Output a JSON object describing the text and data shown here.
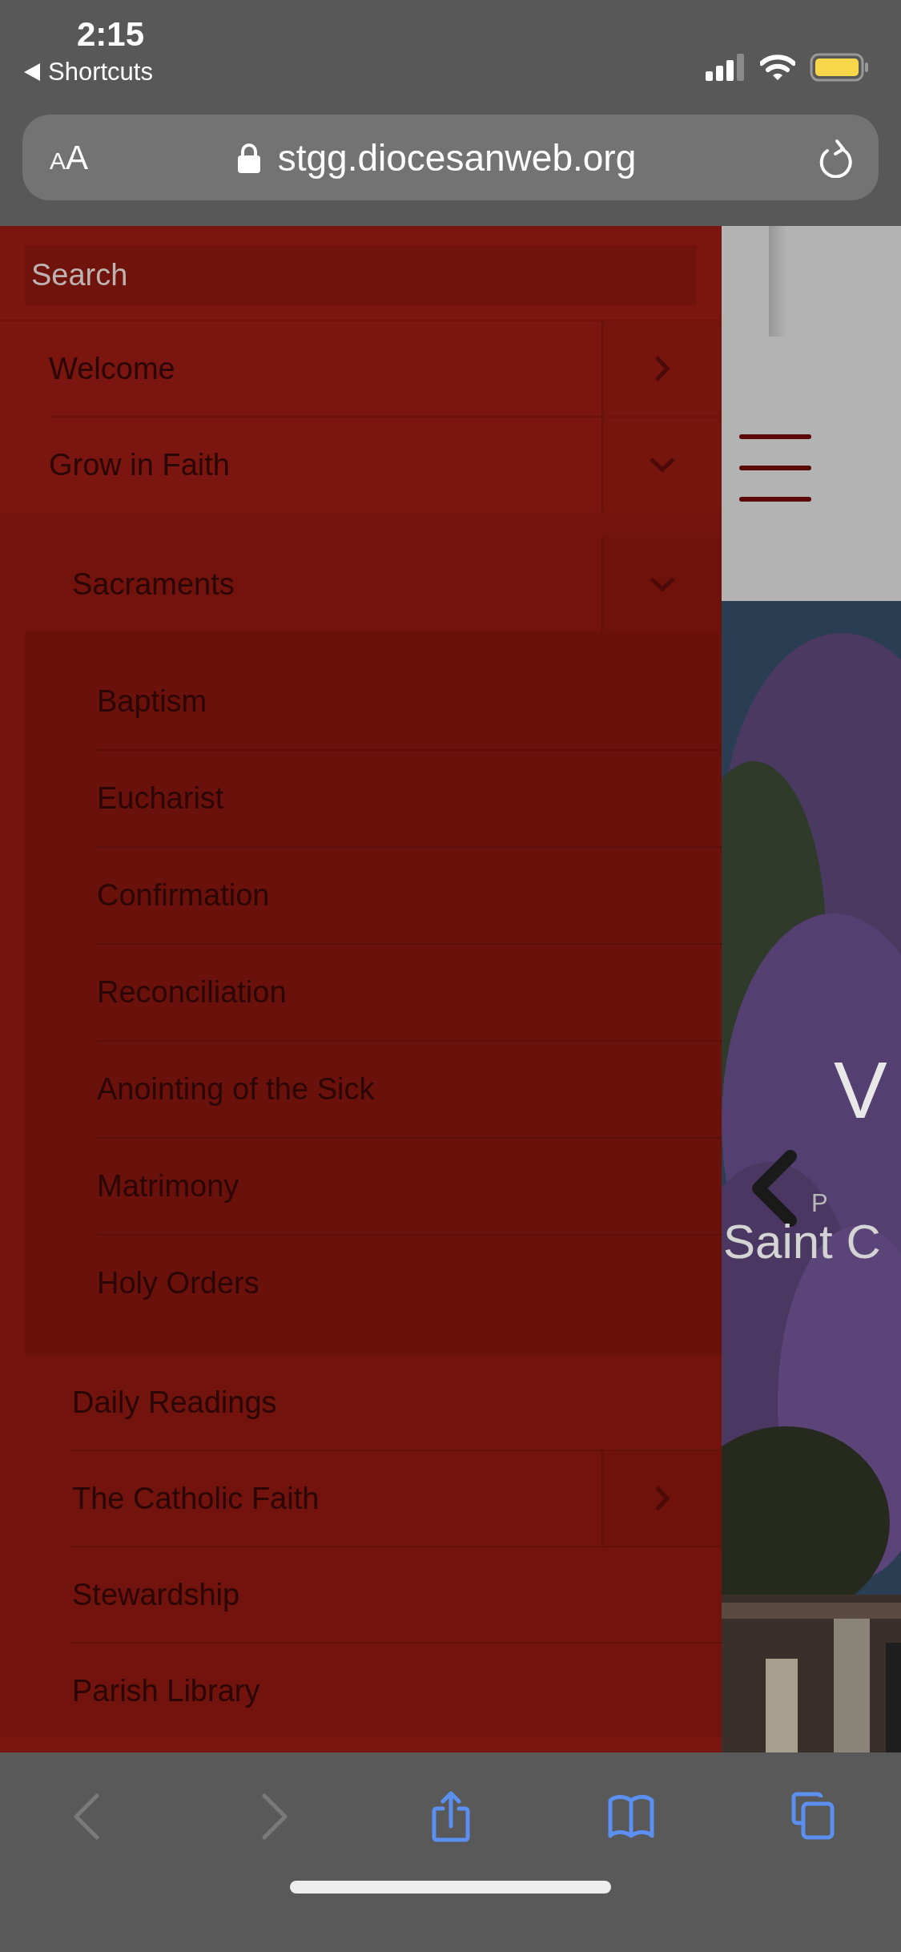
{
  "status_bar": {
    "time": "2:15",
    "back_link": "Shortcuts"
  },
  "address_bar": {
    "text_size_button": "AA",
    "url": "stgg.diocesanweb.org"
  },
  "menu": {
    "search": {
      "placeholder": "Search"
    },
    "items": [
      {
        "label": "Welcome",
        "expanded": false
      },
      {
        "label": "Grow in Faith",
        "expanded": true,
        "children": [
          {
            "label": "Sacraments",
            "expanded": true,
            "children": [
              {
                "label": "Baptism"
              },
              {
                "label": "Eucharist"
              },
              {
                "label": "Confirmation"
              },
              {
                "label": "Reconciliation"
              },
              {
                "label": "Anointing of the Sick"
              },
              {
                "label": "Matrimony"
              },
              {
                "label": "Holy Orders"
              }
            ]
          },
          {
            "label": "Daily Readings"
          },
          {
            "label": "The Catholic Faith",
            "expanded": false
          },
          {
            "label": "Stewardship"
          },
          {
            "label": "Parish Library"
          }
        ]
      }
    ]
  },
  "site": {
    "hero": {
      "kind": "picture",
      "heading": "V",
      "caption_letter": "P",
      "subtitle": "Saint C"
    }
  },
  "toolbar": [
    {
      "kind": "back",
      "disabled": true
    },
    {
      "kind": "forward",
      "disabled": true
    },
    {
      "kind": "share",
      "disabled": false
    },
    {
      "kind": "bookmarks",
      "disabled": false
    },
    {
      "kind": "tabs",
      "disabled": false
    }
  ]
}
